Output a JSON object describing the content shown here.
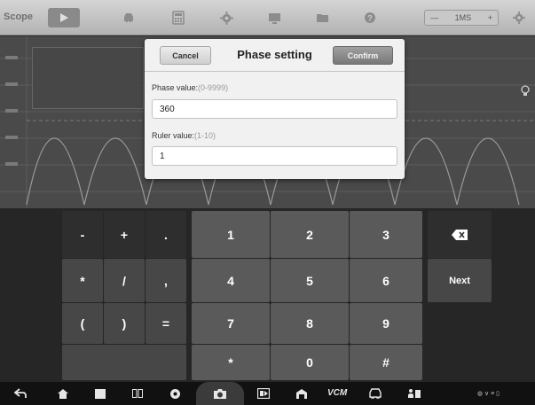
{
  "toolbar": {
    "app_title": "Scope",
    "timebase_value": "1MS",
    "icons": [
      "play-icon",
      "car-icon",
      "calculator-icon",
      "gear-icon",
      "display-icon",
      "folder-icon",
      "help-icon",
      "settings-icon"
    ]
  },
  "dialog": {
    "title": "Phase setting",
    "cancel_label": "Cancel",
    "confirm_label": "Confirm",
    "phase": {
      "label": "Phase value:",
      "range": "(0-9999)",
      "value": "360"
    },
    "ruler": {
      "label": "Ruler value:",
      "range": "(1-10)",
      "value": "1"
    }
  },
  "keyboard": {
    "symbols": [
      "-",
      "+",
      ".",
      "*",
      "/",
      ",",
      "(",
      ")",
      "="
    ],
    "numpad": [
      "1",
      "2",
      "3",
      "4",
      "5",
      "6",
      "7",
      "8",
      "9",
      "*",
      "0",
      "#"
    ],
    "next_label": "Next"
  },
  "navbar": {
    "vcm_label": "VCM",
    "status_text": "◍ ∨ ≡ ▯"
  },
  "colors": {
    "keyboard_bg": "#262626",
    "key_light": "#5a5a5a",
    "key_mid": "#474747",
    "dialog_bg": "#f1f1f1"
  }
}
